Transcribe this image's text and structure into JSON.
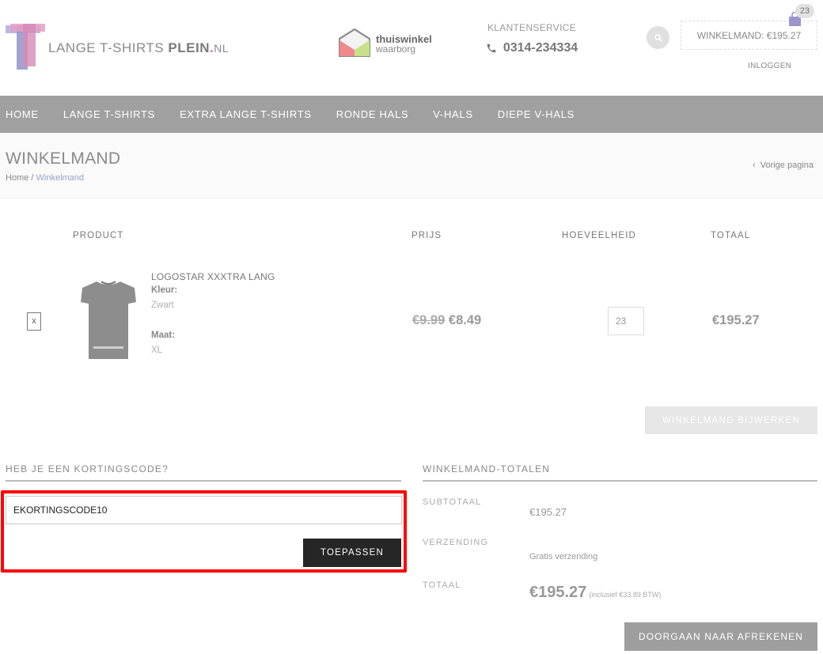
{
  "header": {
    "logo_part1": "LANGE T-SHIRTS ",
    "logo_part2": "PLEIN",
    "logo_dot": ".",
    "logo_part3": "NL",
    "badge_line1": "thuiswinkel",
    "badge_line2": "waarborg",
    "service_label": "KLANTENSERVICE",
    "service_phone": "0314-234334",
    "cart_label": "WINKELMAND: €195.27",
    "cart_count": "23",
    "login_label": "INLOGGEN"
  },
  "nav": {
    "items": [
      "HOME",
      "LANGE T-SHIRTS",
      "EXTRA LANGE T-SHIRTS",
      "RONDE HALS",
      "V-HALS",
      "DIEPE V-HALS"
    ]
  },
  "page": {
    "title": "WINKELMAND",
    "breadcrumb_home": "Home",
    "breadcrumb_sep": " / ",
    "breadcrumb_current": "Winkelmand",
    "back_label": "Vorige pagina"
  },
  "table": {
    "headers": {
      "product": "PRODUCT",
      "price": "PRIJS",
      "quantity": "HOEVEELHEID",
      "total": "TOTAAL"
    },
    "row": {
      "remove": "x",
      "name": "LOGOSTAR XXXTRA LANG",
      "color_label": "Kleur:",
      "color_value": "Zwart",
      "size_label": "Maat:",
      "size_value": "XL",
      "price_old": "€9.99",
      "price_new": "€8.49",
      "quantity": "23",
      "total": "€195.27"
    },
    "update_button": "WINKELMAND BIJWERKEN"
  },
  "coupon": {
    "heading": "HEB JE EEN KORTINGSCODE?",
    "value": "EKORTINGSCODE10",
    "apply_button": "TOEPASSEN"
  },
  "totals": {
    "heading": "WINKELMAND-TOTALEN",
    "subtotal_label": "SUBTOTAAL",
    "subtotal_value": "€195.27",
    "shipping_label": "VERZENDING",
    "shipping_value": "Gratis verzending",
    "total_label": "TOTAAL",
    "total_value": "€195.27",
    "tax_note": "(inclusief €33.89 BTW)",
    "checkout_button": "DOORGAAN NAAR AFREKENEN"
  },
  "colors": {
    "highlight": "#ff0000",
    "nav_bg": "#a0a0a0",
    "apply_bg": "#262626",
    "checkout_bg": "#9e9e9e"
  }
}
